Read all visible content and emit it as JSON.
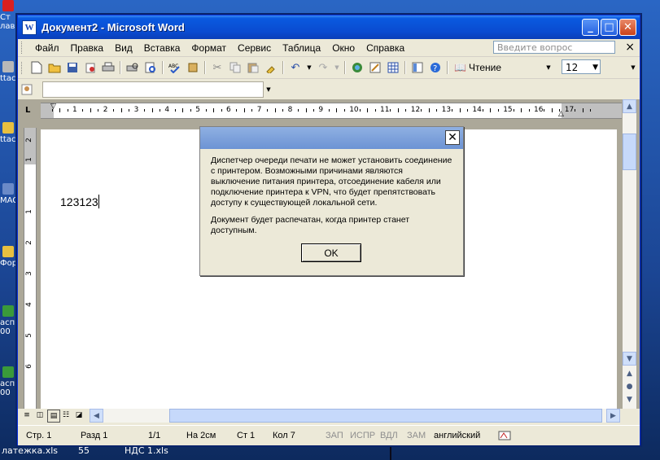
{
  "desktop": {
    "icons": [
      "Ст\nлав",
      "ttac",
      "ttac",
      "MAG",
      "Фор",
      "асп\n00",
      "асп\n00"
    ],
    "taskbar": [
      "латежка.xls",
      "55",
      "НДС 1.xls"
    ]
  },
  "window": {
    "title": "Документ2 - Microsoft Word",
    "app_icon_letter": "W",
    "controls": {
      "minimize": "_",
      "maximize": "□",
      "close": "✕"
    }
  },
  "menu": {
    "items": [
      "Файл",
      "Правка",
      "Вид",
      "Вставка",
      "Формат",
      "Сервис",
      "Таблица",
      "Окно",
      "Справка"
    ],
    "ask_placeholder": "Введите вопрос",
    "close_glyph": "×"
  },
  "toolbar": {
    "read_label": "Чтение",
    "font_size": "12"
  },
  "ruler": {
    "h_numbers": [
      "1",
      "2",
      "3",
      "4",
      "5",
      "6",
      "7",
      "8",
      "9",
      "10",
      "11",
      "12",
      "13",
      "14",
      "15",
      "16",
      "17"
    ],
    "v_numbers": [
      "2",
      "1",
      "1",
      "2",
      "3",
      "4",
      "5",
      "6"
    ]
  },
  "document": {
    "text": "123123"
  },
  "dialog": {
    "close_glyph": "✕",
    "message_1": "Диспетчер очереди печати не может установить соединение с принтером. Возможными причинами являются выключение питания принтера, отсоединение кабеля или подключение принтера к VPN, что будет препятствовать доступу к существующей локальной сети.",
    "message_2": "Документ будет распечатан, когда принтер станет доступным.",
    "ok_label": "OK"
  },
  "status": {
    "page": "Стр. 1",
    "section": "Разд 1",
    "pages": "1/1",
    "at": "На 2см",
    "line": "Ст 1",
    "col": "Кол 7",
    "rec": "ЗАП",
    "trk": "ИСПР",
    "ext": "ВДЛ",
    "ovr": "ЗАМ",
    "language": "английский"
  }
}
